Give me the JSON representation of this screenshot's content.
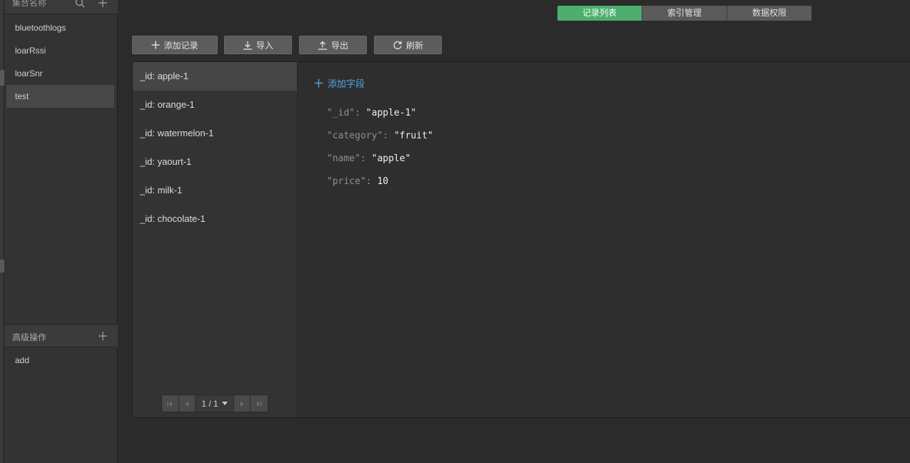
{
  "sidebar": {
    "header_title": "集合名称",
    "collections": [
      {
        "label": "bluetoothlogs"
      },
      {
        "label": "loarRssi"
      },
      {
        "label": "loarSnr"
      },
      {
        "label": "test"
      }
    ],
    "advanced_title": "高级操作",
    "advanced_items": [
      {
        "label": "add"
      }
    ]
  },
  "tabs": [
    {
      "label": "记录列表",
      "active": true
    },
    {
      "label": "索引管理",
      "active": false
    },
    {
      "label": "数据权限",
      "active": false
    }
  ],
  "toolbar": {
    "add_record": "添加记录",
    "import": "导入",
    "export": "导出",
    "refresh": "刷新"
  },
  "records": [
    {
      "label": "_id: apple-1"
    },
    {
      "label": "_id: orange-1"
    },
    {
      "label": "_id: watermelon-1"
    },
    {
      "label": "_id: yaourt-1"
    },
    {
      "label": "_id: milk-1"
    },
    {
      "label": "_id: chocolate-1"
    }
  ],
  "pagination": {
    "page_text": "1 / 1"
  },
  "detail": {
    "add_field": "添加字段",
    "fields": [
      {
        "key": "\"_id\"",
        "value": "\"apple-1\""
      },
      {
        "key": "\"category\"",
        "value": "\"fruit\""
      },
      {
        "key": "\"name\"",
        "value": "\"apple\""
      },
      {
        "key": "\"price\"",
        "value": "10"
      }
    ]
  },
  "colors": {
    "accent_green": "#4caf6e",
    "link_blue": "#4ea6e6",
    "background": "#2b2b2b"
  }
}
